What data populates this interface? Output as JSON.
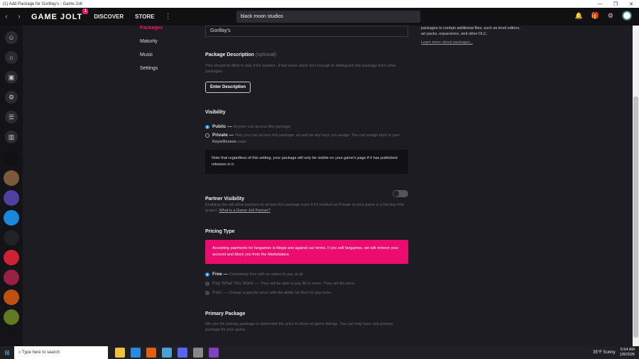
{
  "window": {
    "title": "(1) Add Package for Gorillay's - Game Jolt",
    "min": "—",
    "max": "❐",
    "close": "✕"
  },
  "appbar": {
    "back": "‹",
    "forward": "›",
    "logo_text": "GAME JOLT",
    "logo_badge": "1",
    "discover": "DISCOVER",
    "store": "STORE",
    "more": "⋮",
    "search_value": "black moon studios",
    "bell": "🔔",
    "gift": "🎁",
    "settings": "⚙"
  },
  "leftbar": {
    "icons": [
      "☺",
      "⌂",
      "▣",
      "⚙",
      "☰",
      "▥"
    ],
    "games": [
      "#111",
      "#7a5a3a",
      "#5040a0",
      "#1a88d8",
      "#222",
      "#cc2233",
      "#992244",
      "#c05010",
      "#5f7a20"
    ]
  },
  "subnav": {
    "items": [
      "Packages",
      "Maturity",
      "Music",
      "Settings"
    ]
  },
  "form": {
    "name_value": "Gorillay's",
    "desc_title": "Package Description",
    "desc_optional": "(optional)",
    "desc_help": "This should be filled in only if it's needed , if the name alone isn't enough to distinguish this package from other packages.",
    "desc_button": "Enter Description",
    "visibility_title": "Visibility",
    "public_label": "Public —",
    "public_desc": "Anyone can access this package.",
    "private_label": "Private —",
    "private_desc": "Only you can access this package, as well as any keys you assign. You can assign keys in your",
    "private_link": "Keys/Access",
    "private_tail": "page.",
    "visibility_note": "Note that regardless of this setting, your package will only be visible on your game's page if it has published releases in it.",
    "partner_title": "Partner Visibility",
    "partner_help": "Enabling this will allow partners to access this package even if it's marked as Private or your game is a Devlog-only project.",
    "partner_link": "What is a Game Jolt Partner?",
    "pricing_title": "Pricing Type",
    "pricing_alert": "Accepting payments for fangames is illegal and against our terms. If you sell fangames, we will remove your account and block you from the Marketplace.",
    "free_label": "Free —",
    "free_desc": "Completely free with no option to pay at all.",
    "pwyw_label": "Pay What You Want —",
    "pwyw_desc": "They will be able to pay $0 or more. They set the price.",
    "paid_label": "Paid —",
    "paid_desc": "Charge a specific price with the ability for them to pay more.",
    "primary_title": "Primary Package",
    "primary_help": "We use the primary package to determine the price to show on game listings. You can only have one primary package for your game."
  },
  "rightcol": {
    "text_top": "packages to contain additional files, such as level editors, art packs, expansions, and other DLC.",
    "learn_more": "Learn more about packages..."
  },
  "taskbar": {
    "search_placeholder": "Type here to search",
    "weather": "35°F  Sunny",
    "time": "5:54 AM",
    "date": "1/8/2026",
    "apps": [
      "#f0c040",
      "#2a8ae0",
      "#e06010",
      "#4aa0d0",
      "#5865f2",
      "#888",
      "#8040c0"
    ]
  },
  "colors": {
    "accent": "#e8175d",
    "alert": "#ec0b6f",
    "radio_on": "#2196f3"
  }
}
